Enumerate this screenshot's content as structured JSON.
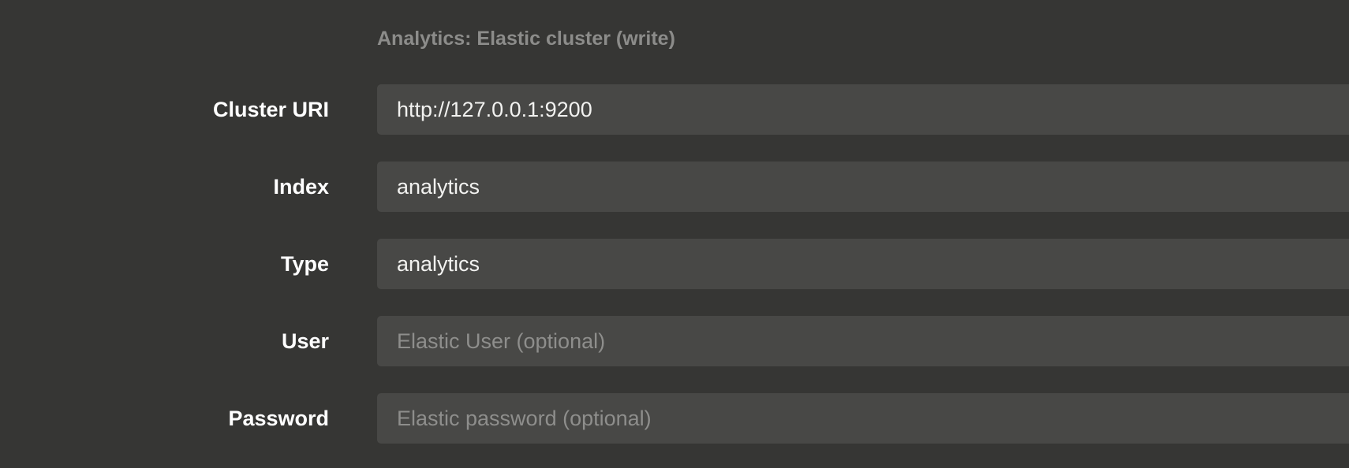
{
  "section": {
    "title": "Analytics: Elastic cluster (write)"
  },
  "fields": [
    {
      "label": "Cluster URI",
      "value": "http://127.0.0.1:9200",
      "placeholder": ""
    },
    {
      "label": "Index",
      "value": "analytics",
      "placeholder": ""
    },
    {
      "label": "Type",
      "value": "analytics",
      "placeholder": ""
    },
    {
      "label": "User",
      "value": "",
      "placeholder": "Elastic User (optional)"
    },
    {
      "label": "Password",
      "value": "",
      "placeholder": "Elastic password (optional)"
    }
  ],
  "colors": {
    "background": "#363634",
    "field_background": "#484846",
    "label_text": "#ffffff",
    "title_text": "#8c8c8a",
    "placeholder_text": "#8e8e8c"
  }
}
